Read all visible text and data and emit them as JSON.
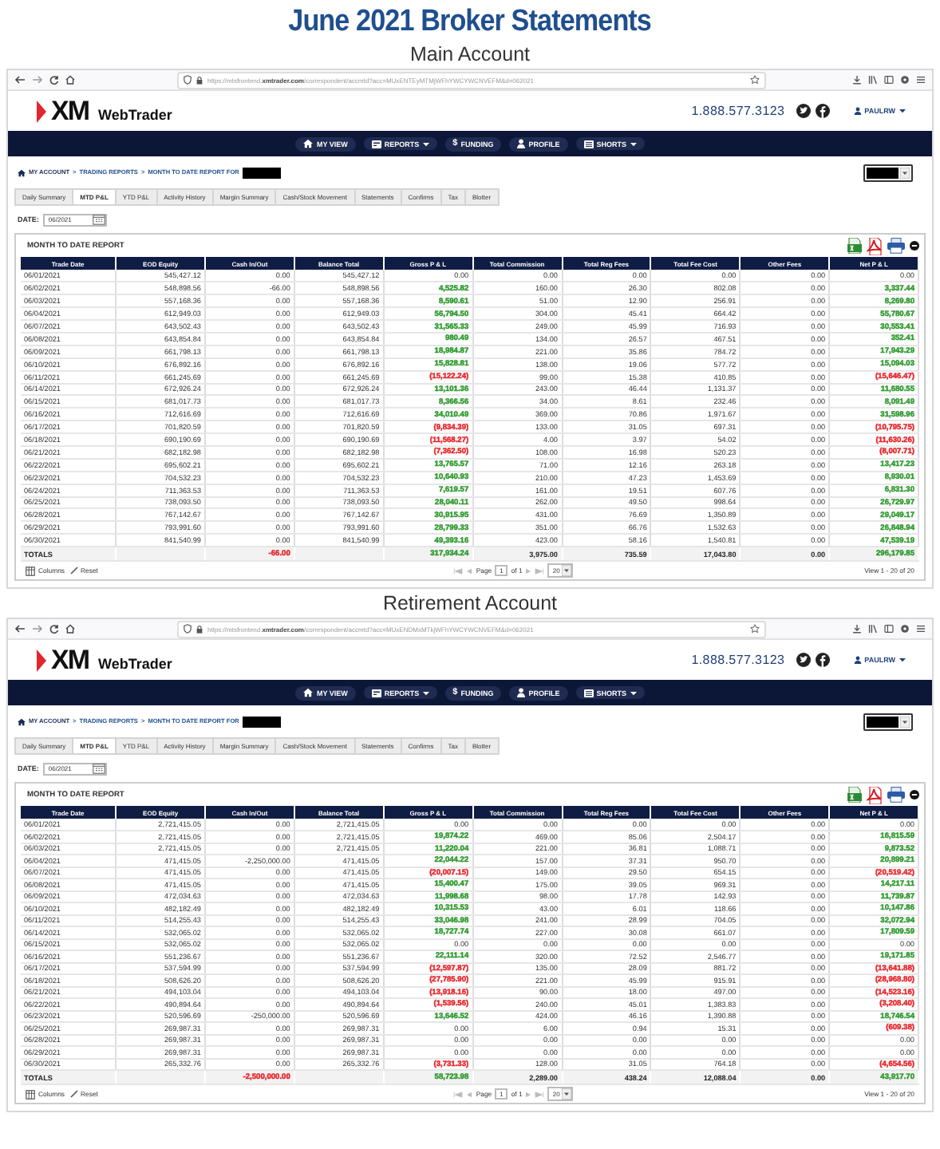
{
  "title": "June 2021 Broker Statements",
  "accounts": [
    {
      "heading": "Main Account",
      "browser": {
        "url_prefix": "https://mtsfrontend.",
        "url_domain": "xmtrader.com",
        "url_path": "/correspondent/accmtd?acc=MUxENTEyMTMjWFhYWCYWCNVEFM&d=062021"
      },
      "brand": {
        "mark": "XM",
        "name": "WebTrader"
      },
      "phone": "1.888.577.3123",
      "user": "PAULRW",
      "nav": [
        {
          "label": "MY VIEW",
          "caret": false
        },
        {
          "label": "REPORTS",
          "caret": true
        },
        {
          "label": "FUNDING",
          "glyph": "$",
          "caret": false
        },
        {
          "label": "PROFILE",
          "caret": false
        },
        {
          "label": "SHORTS",
          "caret": true
        }
      ],
      "breadcrumb": [
        "MY ACCOUNT",
        "TRADING REPORTS",
        "MONTH TO DATE REPORT FOR"
      ],
      "separator": ">",
      "tabs": [
        {
          "label": "Daily Summary",
          "selected": false
        },
        {
          "label": "MTD P&L",
          "selected": true
        },
        {
          "label": "YTD P&L",
          "selected": false
        },
        {
          "label": "Activity History",
          "selected": false
        },
        {
          "label": "Margin Summary",
          "selected": false
        },
        {
          "label": "Cash/Stock Movement",
          "selected": false
        },
        {
          "label": "Statements",
          "selected": false
        },
        {
          "label": "Confirms",
          "selected": false
        },
        {
          "label": "Tax",
          "selected": false
        },
        {
          "label": "Blotter",
          "selected": false
        }
      ],
      "date_label": "DATE:",
      "date_value": "06/2021",
      "report_title": "MONTH TO DATE REPORT",
      "columns": [
        "Trade Date",
        "EOD Equity",
        "Cash In/Out",
        "Balance Total",
        "Gross P & L",
        "Total Commission",
        "Total Reg Fees",
        "Total Fee Cost",
        "Other Fees",
        "Net P & L"
      ],
      "rows": [
        [
          "06/01/2021",
          "545,427.12",
          "0.00",
          "545,427.12",
          "0.00",
          "0.00",
          "0.00",
          "0.00",
          "0.00",
          "0.00"
        ],
        [
          "06/02/2021",
          "548,898.56",
          "-66.00",
          "548,898.56",
          {
            "text": "4,525.82",
            "color": "#2e9a2e"
          },
          "160.00",
          "26.30",
          "802.08",
          "0.00",
          {
            "text": "3,337.44",
            "color": "#2e9a2e"
          }
        ],
        [
          "06/03/2021",
          "557,168.36",
          "0.00",
          "557,168.36",
          {
            "text": "8,590.61",
            "color": "#2e9a2e"
          },
          "51.00",
          "12.90",
          "256.91",
          "0.00",
          {
            "text": "8,269.80",
            "color": "#2e9a2e"
          }
        ],
        [
          "06/04/2021",
          "612,949.03",
          "0.00",
          "612,949.03",
          {
            "text": "56,794.50",
            "color": "#2e9a2e"
          },
          "304.00",
          "45.41",
          "664.42",
          "0.00",
          {
            "text": "55,780.67",
            "color": "#2e9a2e"
          }
        ],
        [
          "06/07/2021",
          "643,502.43",
          "0.00",
          "643,502.43",
          {
            "text": "31,565.33",
            "color": "#2e9a2e"
          },
          "249.00",
          "45.99",
          "716.93",
          "0.00",
          {
            "text": "30,553.41",
            "color": "#2e9a2e"
          }
        ],
        [
          "06/08/2021",
          "643,854.84",
          "0.00",
          "643,854.84",
          {
            "text": "980.49",
            "color": "#2e9a2e"
          },
          "134.00",
          "26.57",
          "467.51",
          "0.00",
          {
            "text": "352.41",
            "color": "#2e9a2e"
          }
        ],
        [
          "06/09/2021",
          "661,798.13",
          "0.00",
          "661,798.13",
          {
            "text": "18,984.87",
            "color": "#2e9a2e"
          },
          "221.00",
          "35.86",
          "784.72",
          "0.00",
          {
            "text": "17,943.29",
            "color": "#2e9a2e"
          }
        ],
        [
          "06/10/2021",
          "676,892.16",
          "0.00",
          "676,892.16",
          {
            "text": "15,828.81",
            "color": "#2e9a2e"
          },
          "138.00",
          "19.06",
          "577.72",
          "0.00",
          {
            "text": "15,094.03",
            "color": "#2e9a2e"
          }
        ],
        [
          "06/11/2021",
          "661,245.69",
          "0.00",
          "661,245.69",
          {
            "text": "(15,122.24)",
            "color": "#e8262b"
          },
          "99.00",
          "15.38",
          "410.85",
          "0.00",
          {
            "text": "(15,646.47)",
            "color": "#e8262b"
          }
        ],
        [
          "06/14/2021",
          "672,926.24",
          "0.00",
          "672,926.24",
          {
            "text": "13,101.36",
            "color": "#2e9a2e"
          },
          "243.00",
          "46.44",
          "1,131.37",
          "0.00",
          {
            "text": "11,680.55",
            "color": "#2e9a2e"
          }
        ],
        [
          "06/15/2021",
          "681,017.73",
          "0.00",
          "681,017.73",
          {
            "text": "8,366.56",
            "color": "#2e9a2e"
          },
          "34.00",
          "8.61",
          "232.46",
          "0.00",
          {
            "text": "8,091.49",
            "color": "#2e9a2e"
          }
        ],
        [
          "06/16/2021",
          "712,616.69",
          "0.00",
          "712,616.69",
          {
            "text": "34,010.49",
            "color": "#2e9a2e"
          },
          "369.00",
          "70.86",
          "1,971.67",
          "0.00",
          {
            "text": "31,598.96",
            "color": "#2e9a2e"
          }
        ],
        [
          "06/17/2021",
          "701,820.59",
          "0.00",
          "701,820.59",
          {
            "text": "(9,834.39)",
            "color": "#e8262b"
          },
          "133.00",
          "31.05",
          "697.31",
          "0.00",
          {
            "text": "(10,795.75)",
            "color": "#e8262b"
          }
        ],
        [
          "06/18/2021",
          "690,190.69",
          "0.00",
          "690,190.69",
          {
            "text": "(11,568.27)",
            "color": "#e8262b"
          },
          "4.00",
          "3.97",
          "54.02",
          "0.00",
          {
            "text": "(11,630.26)",
            "color": "#e8262b"
          }
        ],
        [
          "06/21/2021",
          "682,182.98",
          "0.00",
          "682,182.98",
          {
            "text": "(7,362.50)",
            "color": "#e8262b"
          },
          "108.00",
          "16.98",
          "520.23",
          "0.00",
          {
            "text": "(8,007.71)",
            "color": "#e8262b"
          }
        ],
        [
          "06/22/2021",
          "695,602.21",
          "0.00",
          "695,602.21",
          {
            "text": "13,765.57",
            "color": "#2e9a2e"
          },
          "71.00",
          "12.16",
          "263.18",
          "0.00",
          {
            "text": "13,417.23",
            "color": "#2e9a2e"
          }
        ],
        [
          "06/23/2021",
          "704,532.23",
          "0.00",
          "704,532.23",
          {
            "text": "10,640.93",
            "color": "#2e9a2e"
          },
          "210.00",
          "47.23",
          "1,453.69",
          "0.00",
          {
            "text": "8,930.01",
            "color": "#2e9a2e"
          }
        ],
        [
          "06/24/2021",
          "711,363.53",
          "0.00",
          "711,363.53",
          {
            "text": "7,619.57",
            "color": "#2e9a2e"
          },
          "161.00",
          "19.51",
          "607.76",
          "0.00",
          {
            "text": "6,831.30",
            "color": "#2e9a2e"
          }
        ],
        [
          "06/25/2021",
          "738,093.50",
          "0.00",
          "738,093.50",
          {
            "text": "28,040.11",
            "color": "#2e9a2e"
          },
          "262.00",
          "49.50",
          "998.64",
          "0.00",
          {
            "text": "26,729.97",
            "color": "#2e9a2e"
          }
        ],
        [
          "06/28/2021",
          "767,142.67",
          "0.00",
          "767,142.67",
          {
            "text": "30,915.95",
            "color": "#2e9a2e"
          },
          "431.00",
          "76.69",
          "1,350.89",
          "0.00",
          {
            "text": "29,049.17",
            "color": "#2e9a2e"
          }
        ],
        [
          "06/29/2021",
          "793,991.60",
          "0.00",
          "793,991.60",
          {
            "text": "28,799.33",
            "color": "#2e9a2e"
          },
          "351.00",
          "66.76",
          "1,532.63",
          "0.00",
          {
            "text": "26,848.94",
            "color": "#2e9a2e"
          }
        ],
        [
          "06/30/2021",
          "841,540.99",
          "0.00",
          "841,540.99",
          {
            "text": "49,393.16",
            "color": "#2e9a2e"
          },
          "423.00",
          "58.16",
          "1,540.81",
          "0.00",
          {
            "text": "47,539.19",
            "color": "#2e9a2e"
          }
        ]
      ],
      "totals": [
        {
          "kind": "label",
          "text": "TOTALS"
        },
        {
          "kind": "blank"
        },
        {
          "kind": "value",
          "text": "-66.00",
          "color": "#e8262b"
        },
        {
          "kind": "blank"
        },
        {
          "kind": "value",
          "text": "317,934.24",
          "color": "#2e9a2e"
        },
        {
          "kind": "value",
          "text": "3,975.00"
        },
        {
          "kind": "value",
          "text": "735.59"
        },
        {
          "kind": "value",
          "text": "17,043.80"
        },
        {
          "kind": "value",
          "text": "0.00"
        },
        {
          "kind": "value",
          "text": "296,179.85",
          "color": "#2e9a2e"
        }
      ],
      "footer": {
        "columns": "Columns",
        "reset": "Reset",
        "page_label": "Page",
        "page_value": "1",
        "page_of": "of 1",
        "page_size": "20",
        "view": "View 1 - 20 of 20"
      }
    },
    {
      "heading": "Retirement Account",
      "browser": {
        "url_prefix": "https://mtsfrontend.",
        "url_domain": "xmtrader.com",
        "url_path": "/correspondent/accmtd?acc=MUxENDMxMTkjWFhYWCYWCNVEFM&d=062021"
      },
      "brand": {
        "mark": "XM",
        "name": "WebTrader"
      },
      "phone": "1.888.577.3123",
      "user": "PAULRW",
      "nav": [
        {
          "label": "MY VIEW",
          "caret": false
        },
        {
          "label": "REPORTS",
          "caret": true
        },
        {
          "label": "FUNDING",
          "glyph": "$",
          "caret": false
        },
        {
          "label": "PROFILE",
          "caret": false
        },
        {
          "label": "SHORTS",
          "caret": true
        }
      ],
      "breadcrumb": [
        "MY ACCOUNT",
        "TRADING REPORTS",
        "MONTH TO DATE REPORT FOR"
      ],
      "separator": ">",
      "tabs": [
        {
          "label": "Daily Summary",
          "selected": false
        },
        {
          "label": "MTD P&L",
          "selected": true
        },
        {
          "label": "YTD P&L",
          "selected": false
        },
        {
          "label": "Activity History",
          "selected": false
        },
        {
          "label": "Margin Summary",
          "selected": false
        },
        {
          "label": "Cash/Stock Movement",
          "selected": false
        },
        {
          "label": "Statements",
          "selected": false
        },
        {
          "label": "Confirms",
          "selected": false
        },
        {
          "label": "Tax",
          "selected": false
        },
        {
          "label": "Blotter",
          "selected": false
        }
      ],
      "date_label": "DATE:",
      "date_value": "06/2021",
      "report_title": "MONTH TO DATE REPORT",
      "columns": [
        "Trade Date",
        "EOD Equity",
        "Cash In/Out",
        "Balance Total",
        "Gross P & L",
        "Total Commission",
        "Total Reg Fees",
        "Total Fee Cost",
        "Other Fees",
        "Net P & L"
      ],
      "rows": [
        [
          "06/01/2021",
          "2,721,415.05",
          "0.00",
          "2,721,415.05",
          "0.00",
          "0.00",
          "0.00",
          "0.00",
          "0.00",
          "0.00"
        ],
        [
          "06/02/2021",
          "2,721,415.05",
          "0.00",
          "2,721,415.05",
          {
            "text": "19,874.22",
            "color": "#2e9a2e"
          },
          "469.00",
          "85.06",
          "2,504.17",
          "0.00",
          {
            "text": "16,815.59",
            "color": "#2e9a2e"
          }
        ],
        [
          "06/03/2021",
          "2,721,415.05",
          "0.00",
          "2,721,415.05",
          {
            "text": "11,220.04",
            "color": "#2e9a2e"
          },
          "221.00",
          "36.81",
          "1,088.71",
          "0.00",
          {
            "text": "9,873.52",
            "color": "#2e9a2e"
          }
        ],
        [
          "06/04/2021",
          "471,415.05",
          "-2,250,000.00",
          "471,415.05",
          {
            "text": "22,044.22",
            "color": "#2e9a2e"
          },
          "157.00",
          "37.31",
          "950.70",
          "0.00",
          {
            "text": "20,899.21",
            "color": "#2e9a2e"
          }
        ],
        [
          "06/07/2021",
          "471,415.05",
          "0.00",
          "471,415.05",
          {
            "text": "(20,007.15)",
            "color": "#e8262b"
          },
          "149.00",
          "29.50",
          "654.15",
          "0.00",
          {
            "text": "(20,519.42)",
            "color": "#e8262b"
          }
        ],
        [
          "06/08/2021",
          "471,415.05",
          "0.00",
          "471,415.05",
          {
            "text": "15,400.47",
            "color": "#2e9a2e"
          },
          "175.00",
          "39.05",
          "969.31",
          "0.00",
          {
            "text": "14,217.11",
            "color": "#2e9a2e"
          }
        ],
        [
          "06/09/2021",
          "472,034.63",
          "0.00",
          "472,034.63",
          {
            "text": "11,998.68",
            "color": "#2e9a2e"
          },
          "98.00",
          "17.78",
          "142.93",
          "0.00",
          {
            "text": "11,739.87",
            "color": "#2e9a2e"
          }
        ],
        [
          "06/10/2021",
          "482,182.49",
          "0.00",
          "482,182.49",
          {
            "text": "10,315.53",
            "color": "#2e9a2e"
          },
          "43.00",
          "6.01",
          "118.66",
          "0.00",
          {
            "text": "10,147.86",
            "color": "#2e9a2e"
          }
        ],
        [
          "06/11/2021",
          "514,255.43",
          "0.00",
          "514,255.43",
          {
            "text": "33,046.98",
            "color": "#2e9a2e"
          },
          "241.00",
          "28.99",
          "704.05",
          "0.00",
          {
            "text": "32,072.94",
            "color": "#2e9a2e"
          }
        ],
        [
          "06/14/2021",
          "532,065.02",
          "0.00",
          "532,065.02",
          {
            "text": "18,727.74",
            "color": "#2e9a2e"
          },
          "227.00",
          "30.08",
          "661.07",
          "0.00",
          {
            "text": "17,809.59",
            "color": "#2e9a2e"
          }
        ],
        [
          "06/15/2021",
          "532,065.02",
          "0.00",
          "532,065.02",
          "0.00",
          "0.00",
          "0.00",
          "0.00",
          "0.00",
          "0.00"
        ],
        [
          "06/16/2021",
          "551,236.67",
          "0.00",
          "551,236.67",
          {
            "text": "22,111.14",
            "color": "#2e9a2e"
          },
          "320.00",
          "72.52",
          "2,546.77",
          "0.00",
          {
            "text": "19,171.85",
            "color": "#2e9a2e"
          }
        ],
        [
          "06/17/2021",
          "537,594.99",
          "0.00",
          "537,594.99",
          {
            "text": "(12,597.87)",
            "color": "#e8262b"
          },
          "135.00",
          "28.09",
          "881.72",
          "0.00",
          {
            "text": "(13,641.88)",
            "color": "#e8262b"
          }
        ],
        [
          "06/18/2021",
          "508,626.20",
          "0.00",
          "508,626.20",
          {
            "text": "(27,785.90)",
            "color": "#e8262b"
          },
          "221.00",
          "45.99",
          "915.91",
          "0.00",
          {
            "text": "(28,968.80)",
            "color": "#e8262b"
          }
        ],
        [
          "06/21/2021",
          "494,103.04",
          "0.00",
          "494,103.04",
          {
            "text": "(13,918.16)",
            "color": "#e8262b"
          },
          "90.00",
          "18.00",
          "497.00",
          "0.00",
          {
            "text": "(14,523.16)",
            "color": "#e8262b"
          }
        ],
        [
          "06/22/2021",
          "490,894.64",
          "0.00",
          "490,894.64",
          {
            "text": "(1,539.56)",
            "color": "#e8262b"
          },
          "240.00",
          "45.01",
          "1,383.83",
          "0.00",
          {
            "text": "(3,208.40)",
            "color": "#e8262b"
          }
        ],
        [
          "06/23/2021",
          "520,596.69",
          "-250,000.00",
          "520,596.69",
          {
            "text": "13,646.52",
            "color": "#2e9a2e"
          },
          "424.00",
          "46.16",
          "1,390.88",
          "0.00",
          {
            "text": "18,746.54",
            "color": "#2e9a2e"
          }
        ],
        [
          "06/25/2021",
          "269,987.31",
          "0.00",
          "269,987.31",
          "0.00",
          "6.00",
          "0.94",
          "15.31",
          "0.00",
          {
            "text": "(609.38)",
            "color": "#e8262b"
          }
        ],
        [
          "06/28/2021",
          "269,987.31",
          "0.00",
          "269,987.31",
          "0.00",
          "0.00",
          "0.00",
          "0.00",
          "0.00",
          "0.00"
        ],
        [
          "06/29/2021",
          "269,987.31",
          "0.00",
          "269,987.31",
          "0.00",
          "0.00",
          "0.00",
          "0.00",
          "0.00",
          "0.00"
        ],
        [
          "06/30/2021",
          "265,332.76",
          "0.00",
          "265,332.76",
          {
            "text": "(3,731.33)",
            "color": "#e8262b"
          },
          "128.00",
          "31.05",
          "764.18",
          "0.00",
          {
            "text": "(4,654.56)",
            "color": "#e8262b"
          }
        ]
      ],
      "totals": [
        {
          "kind": "label",
          "text": "TOTALS"
        },
        {
          "kind": "blank"
        },
        {
          "kind": "value",
          "text": "-2,500,000.00",
          "color": "#e8262b"
        },
        {
          "kind": "blank"
        },
        {
          "kind": "value",
          "text": "58,723.98",
          "color": "#2e9a2e"
        },
        {
          "kind": "value",
          "text": "2,289.00"
        },
        {
          "kind": "value",
          "text": "438.24"
        },
        {
          "kind": "value",
          "text": "12,088.04"
        },
        {
          "kind": "value",
          "text": "0.00"
        },
        {
          "kind": "value",
          "text": "43,917.70",
          "color": "#2e9a2e"
        }
      ],
      "footer": {
        "columns": "Columns",
        "reset": "Reset",
        "page_label": "Page",
        "page_value": "1",
        "page_of": "of 1",
        "page_size": "20",
        "view": "View 1 - 20 of 20"
      }
    }
  ]
}
